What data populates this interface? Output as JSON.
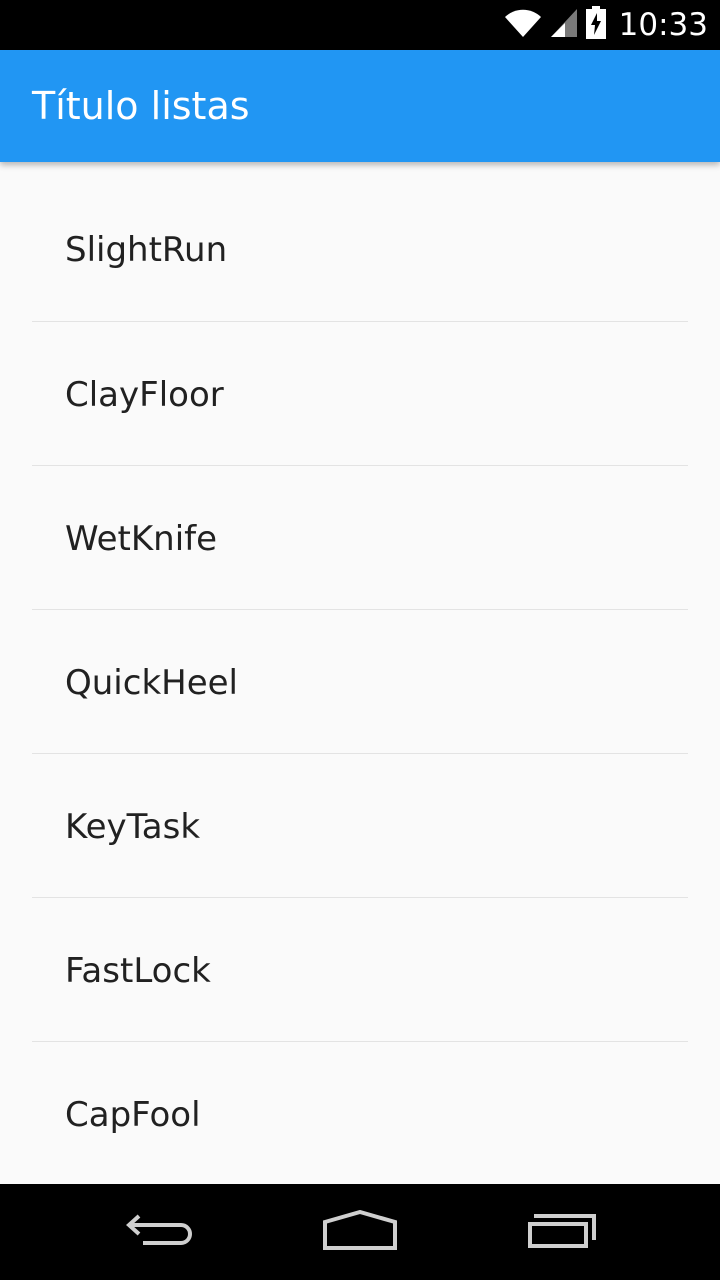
{
  "status_bar": {
    "time": "10:33",
    "icons": [
      "wifi-icon",
      "signal-icon",
      "battery-charging-icon"
    ]
  },
  "app_bar": {
    "title": "Título listas",
    "color": "#2196f3"
  },
  "list": {
    "items": [
      {
        "label": "SlightRun"
      },
      {
        "label": "ClayFloor"
      },
      {
        "label": "WetKnife"
      },
      {
        "label": "QuickHeel"
      },
      {
        "label": "KeyTask"
      },
      {
        "label": "FastLock"
      },
      {
        "label": "CapFool"
      }
    ]
  },
  "nav_bar": {
    "buttons": [
      "back-icon",
      "home-icon",
      "recents-icon"
    ]
  }
}
